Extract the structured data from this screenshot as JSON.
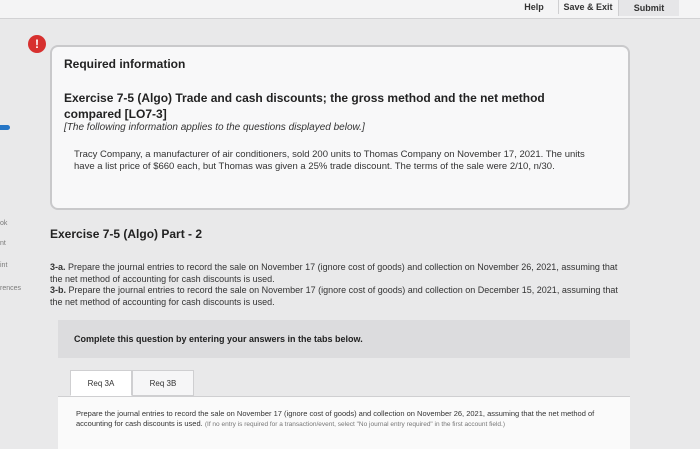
{
  "header": {
    "help_label": "Help",
    "save_exit_label": "Save & Exit",
    "submit_label": "Submit"
  },
  "sidebar": {
    "labels": [
      "ok",
      "nt",
      "int",
      "rences"
    ]
  },
  "info_box": {
    "title": "Required information",
    "heading": "Exercise 7-5 (Algo) Trade and cash discounts; the gross method and the net method compared [LO7-3]",
    "note": "[The following information applies to the questions displayed below.]",
    "body": "Tracy Company, a manufacturer of air conditioners, sold 200 units to Thomas Company on November 17, 2021. The units have a list price of $660 each, but Thomas was given a 25% trade discount. The terms of the sale were 2/10, n/30."
  },
  "part": {
    "title": "Exercise 7-5 (Algo) Part - 2"
  },
  "requirements": {
    "req_3a_label": "3-a.",
    "req_3a_text": "Prepare the journal entries to record the sale on November 17 (ignore cost of goods) and collection on November 26, 2021, assuming that the net method of accounting for cash discounts is used.",
    "req_3b_label": "3-b.",
    "req_3b_text": "Prepare the journal entries to record the sale on November 17 (ignore cost of goods) and collection on December 15, 2021, assuming that the net method of accounting for cash discounts is used."
  },
  "instruction": "Complete this question by entering your answers in the tabs below.",
  "tabs": [
    {
      "label": "Req 3A",
      "active": true
    },
    {
      "label": "Req 3B",
      "active": false
    }
  ],
  "tab_content": {
    "main": "Prepare the journal entries to record the sale on November 17 (ignore cost of goods) and collection on November 26, 2021, assuming that the net method of accounting for cash discounts is used.",
    "hint": "(If no entry is required for a transaction/event, select \"No journal entry required\" in the first account field.)"
  },
  "colors": {
    "alert": "#d7302f",
    "accent": "#2676c6"
  }
}
